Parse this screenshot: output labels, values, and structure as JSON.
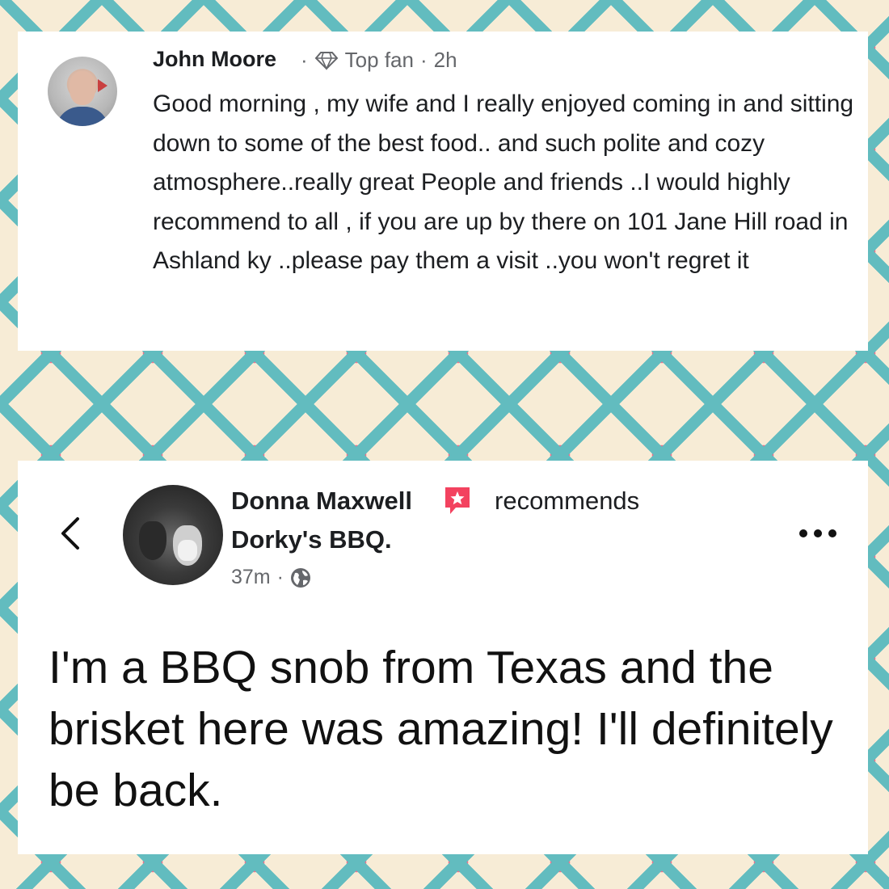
{
  "review_top": {
    "author": "John Moore",
    "separator": "·",
    "badge": "Top fan",
    "time": "2h",
    "text": "Good morning ,  my wife and I really enjoyed coming in and sitting down to some of the best food.. and such polite and cozy atmosphere..really great People and friends ..I would highly recommend to all , if you are up by there on 101 Jane Hill road in Ashland ky ..please pay them a visit ..you won't regret it",
    "icons": {
      "avatar": "profile-photo",
      "badge": "diamond-icon"
    }
  },
  "review_bottom": {
    "author": "Donna Maxwell",
    "action": "recommends",
    "business": "Dorky's BBQ.",
    "time": "37m",
    "separator": "·",
    "text": "I'm a BBQ snob from Texas and the brisket here was amazing! I'll definitely be back.",
    "icons": {
      "back": "chevron-left-icon",
      "recommend": "recommend-star-icon",
      "audience": "globe-icon",
      "more": "more-options-icon"
    }
  },
  "colors": {
    "teal": "#62bcbf",
    "pink": "#ec6f8c",
    "cream": "#f7ecd6",
    "recommend": "#f3425f"
  }
}
